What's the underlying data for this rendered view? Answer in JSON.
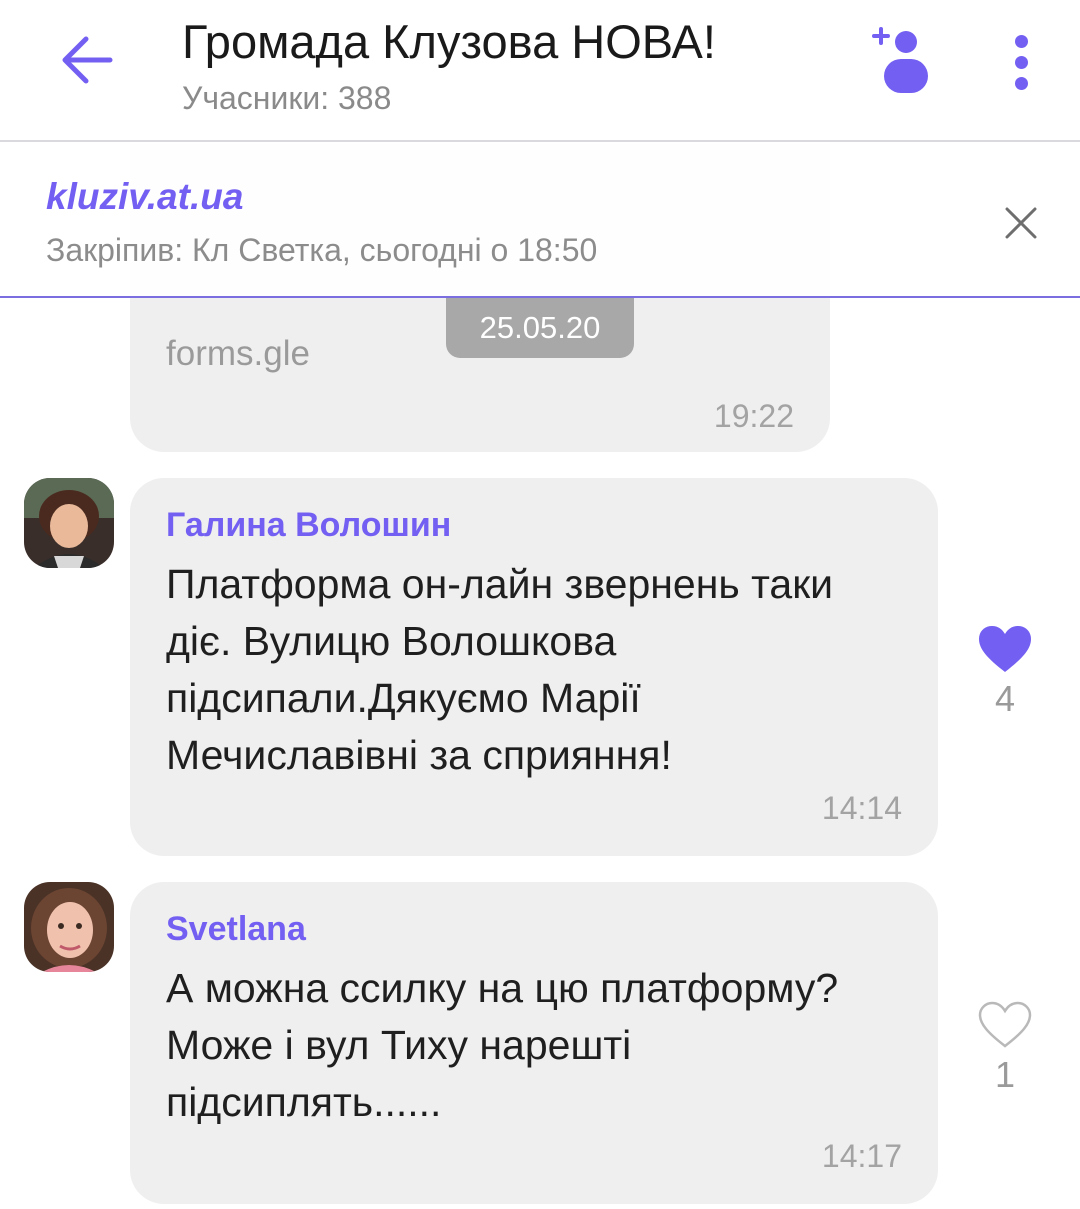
{
  "header": {
    "title": "Громада Клузова НОВА!",
    "subtitle": "Учасники: 388"
  },
  "pinned": {
    "link": "kluziv.at.ua",
    "meta": "Закріпив: Кл Светка, сьогодні о 18:50"
  },
  "date_separator": "25.05.20",
  "previous_message": {
    "link_text": "forms.gle",
    "time": "19:22"
  },
  "messages": [
    {
      "sender": "Галина Волошин",
      "text": "Платформа он-лайн звернень таки діє. Вулицю Волошкова підсипали.Дякуємо Марії Мечиславівні за сприяння!",
      "time": "14:14",
      "likes": "4",
      "liked": true
    },
    {
      "sender": "Svetlana",
      "text": "А можна ссилку на цю платформу? Може і вул Тиху нарешті підсиплять......",
      "time": "14:17",
      "likes": "1",
      "liked": false
    }
  ],
  "colors": {
    "accent": "#7360f2",
    "bubble": "#efefef",
    "date_pill": "#a8a8a8"
  },
  "icons": {
    "back": "arrow-left-icon",
    "add_member": "add-person-icon",
    "more": "more-vertical-icon",
    "close": "close-icon",
    "like": "heart-icon"
  }
}
